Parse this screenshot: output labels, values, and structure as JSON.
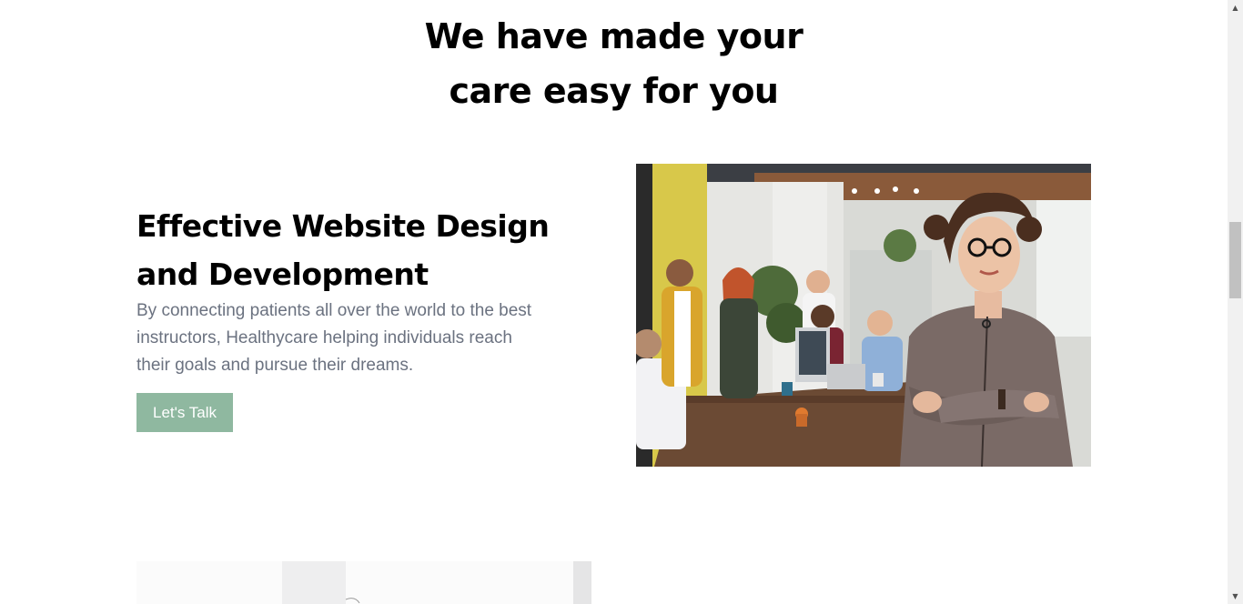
{
  "section": {
    "heading_line1": "We have made your",
    "heading_line2": "care easy for you"
  },
  "feature": {
    "title_line1": "Effective Website Design",
    "title_line2": "and Development",
    "description": "By connecting patients all over the world to the best instructors, Healthycare helping individuals reach their goals and pursue their dreams.",
    "button_label": "Let's Talk"
  },
  "colors": {
    "accent": "#8fb8a0",
    "body_text": "#6b7280",
    "heading": "#000000"
  },
  "icons": {
    "scroll_up": "triangle-up-icon",
    "scroll_down": "triangle-down-icon"
  }
}
